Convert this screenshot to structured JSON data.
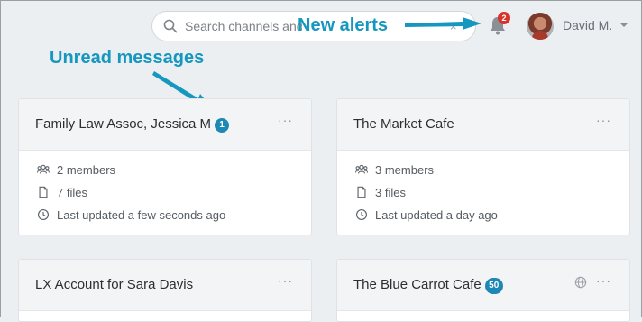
{
  "header": {
    "search_placeholder": "Search channels and messages",
    "clear_glyph": "×",
    "notification_count": "2",
    "user_name": "David M."
  },
  "annotations": {
    "new_alerts": "New alerts",
    "unread_messages": "Unread messages",
    "color": "#1597bf"
  },
  "channels": [
    {
      "name": "Family Law Assoc, Jessica M",
      "unread": "1",
      "members": "2 members",
      "files": "7 files",
      "updated": "Last updated a few seconds ago"
    },
    {
      "name": "The Market Cafe",
      "members": "3 members",
      "files": "3 files",
      "updated": "Last updated a day ago"
    },
    {
      "name": "LX Account for Sara Davis"
    },
    {
      "name": "The Blue Carrot Cafe",
      "unread": "50",
      "public_icon": "globe-icon"
    }
  ],
  "menu_glyph": "···"
}
